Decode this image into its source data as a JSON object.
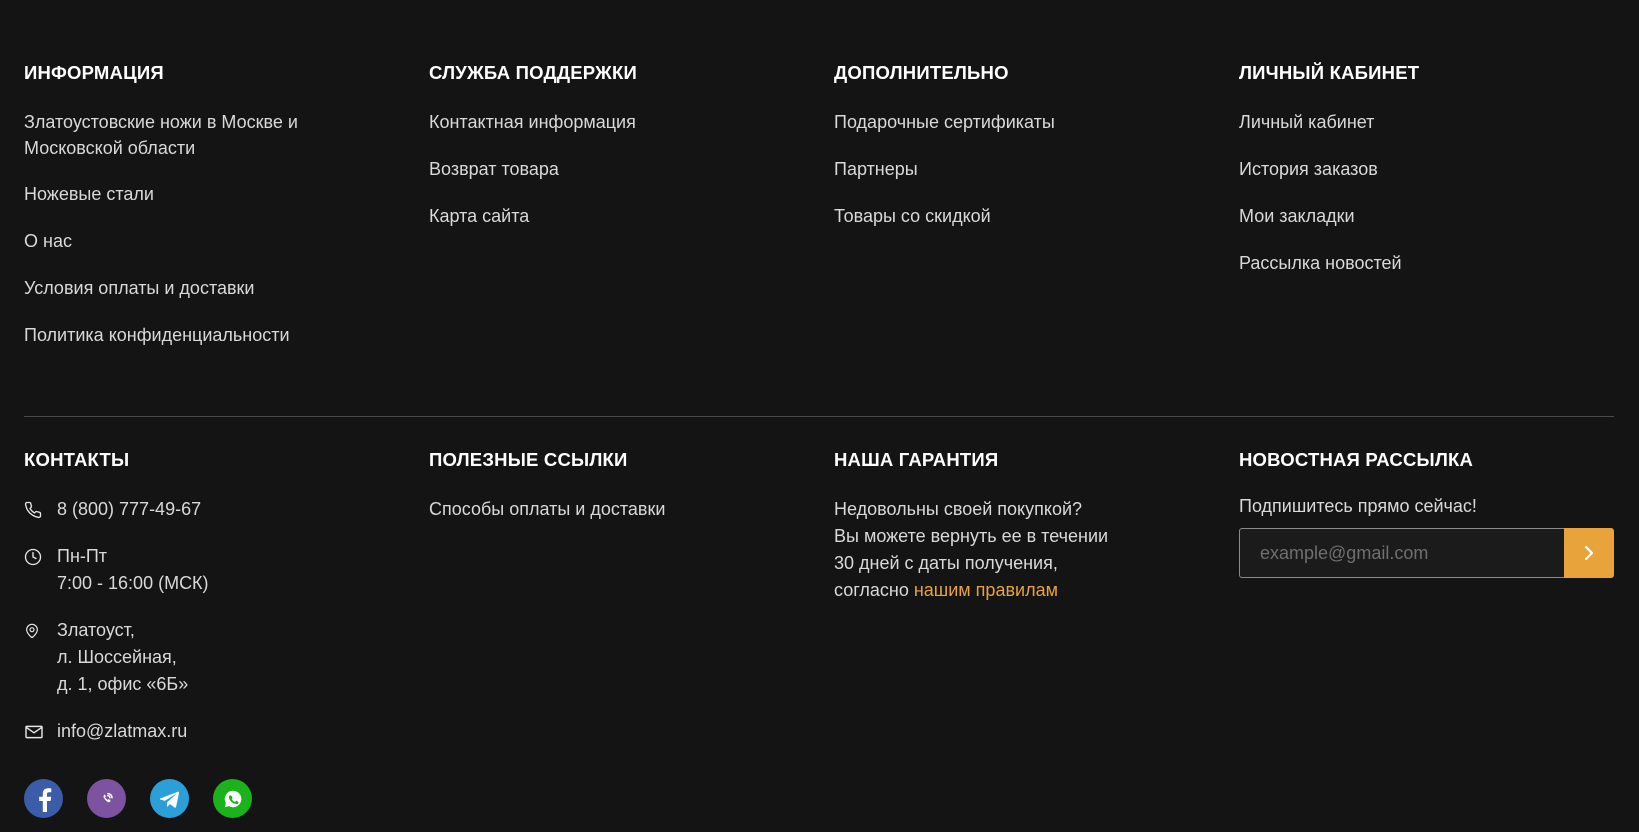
{
  "footer": {
    "columns": [
      {
        "heading": "ИНФОРМАЦИЯ",
        "links": [
          "Златоустовские ножи в Москве и Московской области",
          "Ножевые стали",
          "О нас",
          "Условия оплаты и доставки",
          "Политика конфиденциальности"
        ]
      },
      {
        "heading": "СЛУЖБА ПОДДЕРЖКИ",
        "links": [
          "Контактная информация",
          "Возврат товара",
          "Карта сайта"
        ]
      },
      {
        "heading": "ДОПОЛНИТЕЛЬНО",
        "links": [
          "Подарочные сертификаты",
          "Партнеры",
          "Товары со скидкой"
        ]
      },
      {
        "heading": "ЛИЧНЫЙ КАБИНЕТ",
        "links": [
          "Личный кабинет",
          "История заказов",
          "Мои закладки",
          "Рассылка новостей"
        ]
      }
    ],
    "contacts": {
      "heading": "КОНТАКТЫ",
      "phone": "8 (800) 777-49-67",
      "hours": [
        "Пн-Пт",
        "7:00 - 16:00 (МСК)"
      ],
      "address": [
        "Златоуст,",
        "л. Шоссейная,",
        "д. 1, офис «6Б»"
      ],
      "email": "info@zlatmax.ru"
    },
    "useful_links": {
      "heading": "ПОЛЕЗНЫЕ ССЫЛКИ",
      "links": [
        "Способы оплаты и доставки"
      ]
    },
    "guarantee": {
      "heading": "НАША ГАРАНТИЯ",
      "lines": [
        "Недовольны своей покупкой?",
        "Вы можете вернуть ее в течении",
        "30 дней с даты получения,"
      ],
      "last_prefix": "согласно ",
      "link": "нашим правилам"
    },
    "newsletter": {
      "heading": "НОВОСТНАЯ РАССЫЛКА",
      "text": "Подпишитесь прямо сейчас!",
      "placeholder": "example@gmail.com",
      "value": ""
    },
    "socials": [
      {
        "name": "facebook-icon",
        "color": "#3b5ca8"
      },
      {
        "name": "viber-icon",
        "color": "#7d52a0"
      },
      {
        "name": "telegram-icon",
        "color": "#2a9fd8"
      },
      {
        "name": "whatsapp-icon",
        "color": "#1bb31b"
      }
    ],
    "colors": {
      "background": "#141414",
      "accent": "#e8a33a",
      "text": "#d9d9d9",
      "heading": "#ffffff"
    }
  }
}
